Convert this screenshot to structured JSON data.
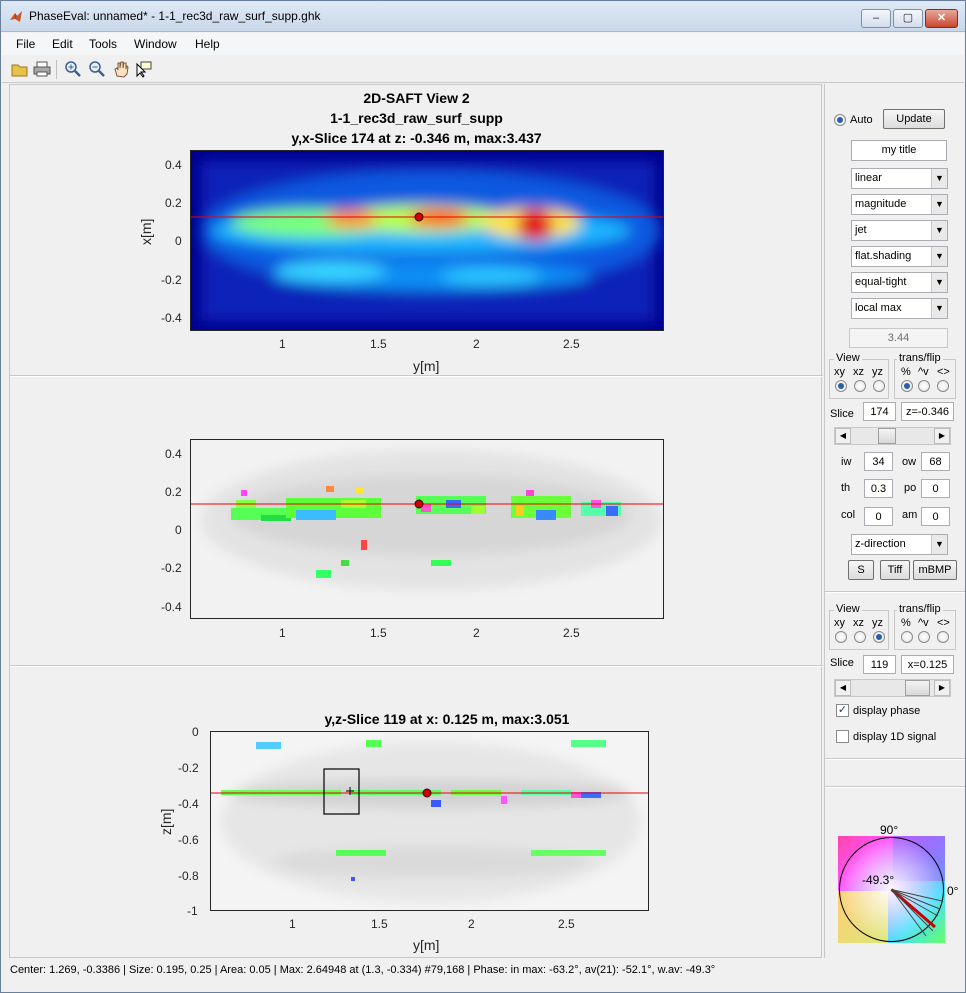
{
  "window": {
    "title": "PhaseEval: unnamed* - 1-1_rec3d_raw_surf_supp.ghk",
    "minimize": "–",
    "maximize": "▢",
    "close": "✕"
  },
  "menu": [
    "File",
    "Edit",
    "Tools",
    "Window",
    "Help"
  ],
  "toolbar": [
    "open-icon",
    "print-icon",
    "zoom-in-icon",
    "zoom-out-icon",
    "pan-hand-icon",
    "data-cursor-icon"
  ],
  "plot1": {
    "title1": "2D-SAFT View 2",
    "title2": "1-1_rec3d_raw_surf_supp",
    "title3": "y,x-Slice 174 at z: -0.346 m, max:3.437",
    "xlabel": "y[m]",
    "ylabel": "x[m]",
    "xticks": [
      "1",
      "1.5",
      "2",
      "2.5"
    ],
    "yticks": [
      "0.4",
      "0.2",
      "0",
      "-0.2",
      "-0.4"
    ]
  },
  "plot2": {
    "xticks": [
      "1",
      "1.5",
      "2",
      "2.5"
    ],
    "yticks": [
      "0.4",
      "0.2",
      "0",
      "-0.2",
      "-0.4"
    ]
  },
  "plot3": {
    "title": "y,z-Slice 119 at x: 0.125 m, max:3.051",
    "xlabel": "y[m]",
    "ylabel": "z[m]",
    "xticks": [
      "1",
      "1.5",
      "2",
      "2.5"
    ],
    "yticks": [
      "0",
      "-0.2",
      "-0.4",
      "-0.6",
      "-0.8",
      "-1"
    ]
  },
  "controls": {
    "auto_label": "Auto",
    "update_label": "Update",
    "title_field": "my title",
    "scale": "linear",
    "mode": "magnitude",
    "colormap": "jet",
    "shading": "flat.shading",
    "aspect": "equal-tight",
    "max_mode": "local max",
    "max_value": "3.44",
    "view1": {
      "view_title": "View",
      "view_opts": [
        "xy",
        "xz",
        "yz"
      ],
      "flip_title": "trans/flip",
      "flip_opts": [
        "%",
        "^v",
        "<>"
      ],
      "slice_label": "Slice",
      "slice_value": "174",
      "pos_value": "z=-0.346"
    },
    "params": {
      "iw_label": "iw",
      "iw": "34",
      "ow_label": "ow",
      "ow": "68",
      "th_label": "th",
      "th": "0.3",
      "po_label": "po",
      "po": "0",
      "col_label": "col",
      "col": "0",
      "am_label": "am",
      "am": "0"
    },
    "direction": "z-direction",
    "s_btn": "S",
    "tiff_btn": "Tiff",
    "mbmp_btn": "mBMP",
    "view2": {
      "view_title": "View",
      "view_opts": [
        "xy",
        "xz",
        "yz"
      ],
      "flip_title": "trans/flip",
      "flip_opts": [
        "%",
        "^v",
        "<>"
      ],
      "slice_label": "Slice",
      "slice_value": "119",
      "pos_value": "x=0.125"
    },
    "display_phase": "display phase",
    "display_1d": "display 1D signal",
    "wheel": {
      "top": "90°",
      "right": "0°",
      "value": "-49.3°"
    }
  },
  "status": "Center:  1.269, -0.3386 | Size:  0.195,  0.25 | Area:   0.05 | Max:  2.64948 at (1.3, -0.334) #79,168 | Phase: in max: -63.2°, av(21): -52.1°, w.av: -49.3°"
}
